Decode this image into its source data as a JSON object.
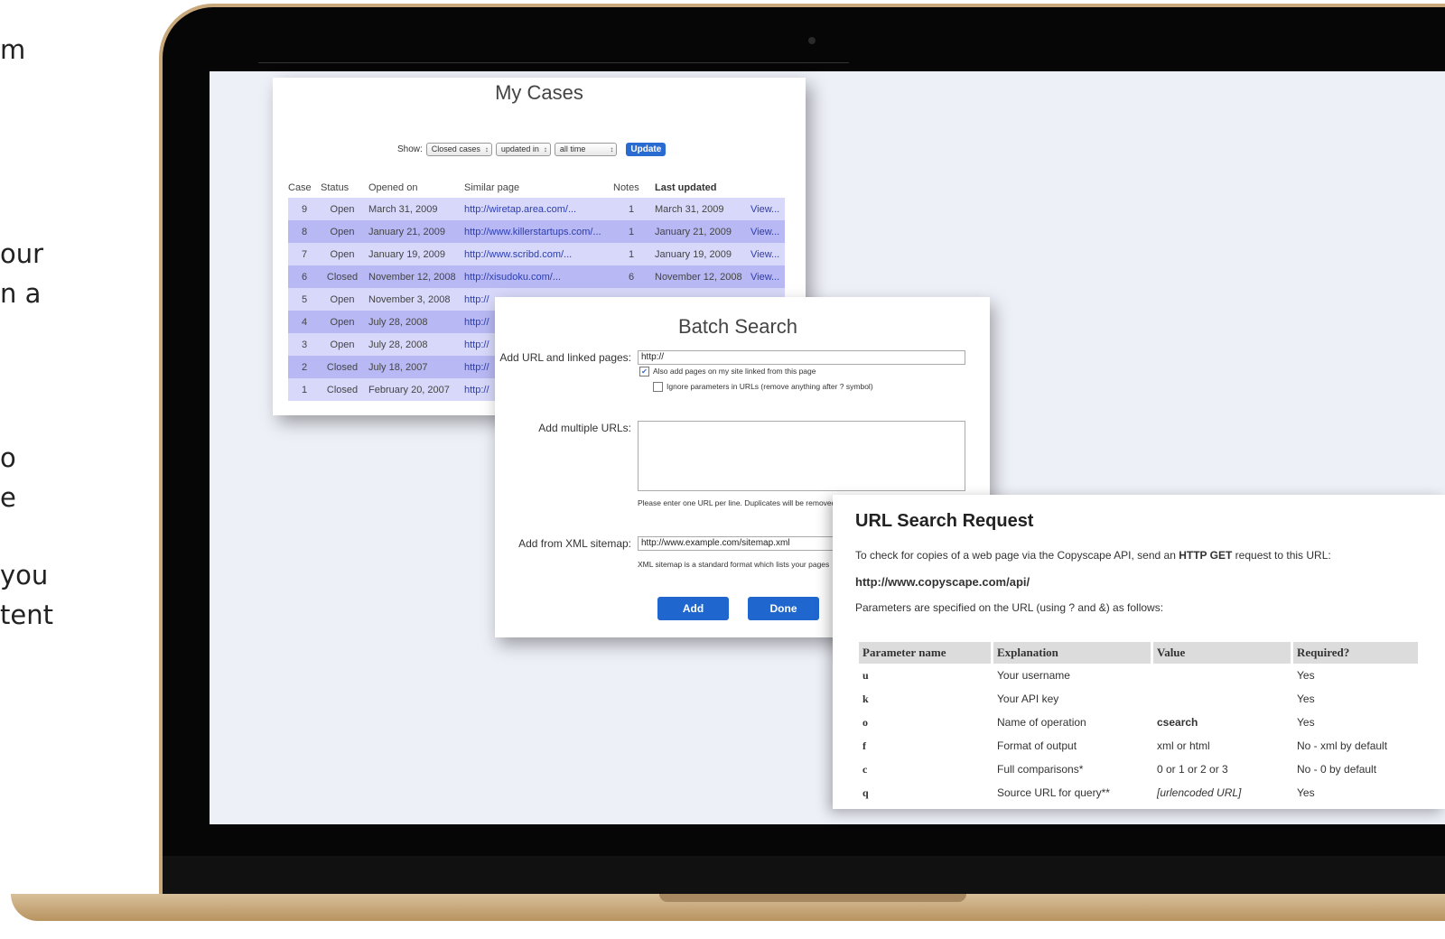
{
  "side_text": [
    "m",
    "our",
    "n a",
    "o",
    "e",
    "you",
    "tent"
  ],
  "my_cases": {
    "title": "My Cases",
    "filter": {
      "show_label": "Show:",
      "status_select": "Closed cases",
      "date_type_select": "updated in",
      "period_select": "all time",
      "update_button": "Update"
    },
    "columns": [
      "Case",
      "Status",
      "Opened on",
      "Similar page",
      "Notes",
      "Last updated"
    ],
    "rows": [
      {
        "case": "9",
        "status": "Open",
        "opened": "March 31, 2009",
        "page": "http://wiretap.area.com/...",
        "notes": "1",
        "updated": "March 31, 2009",
        "action": "View..."
      },
      {
        "case": "8",
        "status": "Open",
        "opened": "January 21, 2009",
        "page": "http://www.killerstartups.com/...",
        "notes": "1",
        "updated": "January 21, 2009",
        "action": "View..."
      },
      {
        "case": "7",
        "status": "Open",
        "opened": "January 19, 2009",
        "page": "http://www.scribd.com/...",
        "notes": "1",
        "updated": "January 19, 2009",
        "action": "View..."
      },
      {
        "case": "6",
        "status": "Closed",
        "opened": "November 12, 2008",
        "page": "http://xisudoku.com/...",
        "notes": "6",
        "updated": "November 12, 2008",
        "action": "View..."
      },
      {
        "case": "5",
        "status": "Open",
        "opened": "November 3, 2008",
        "page": "http://",
        "notes": "",
        "updated": "",
        "action": ""
      },
      {
        "case": "4",
        "status": "Open",
        "opened": "July 28, 2008",
        "page": "http://",
        "notes": "",
        "updated": "",
        "action": ""
      },
      {
        "case": "3",
        "status": "Open",
        "opened": "July 28, 2008",
        "page": "http://",
        "notes": "",
        "updated": "",
        "action": ""
      },
      {
        "case": "2",
        "status": "Closed",
        "opened": "July 18, 2007",
        "page": "http://",
        "notes": "",
        "updated": "",
        "action": ""
      },
      {
        "case": "1",
        "status": "Closed",
        "opened": "February 20, 2007",
        "page": "http://",
        "notes": "",
        "updated": "",
        "action": ""
      }
    ]
  },
  "batch_search": {
    "title": "Batch Search",
    "add_url_label": "Add URL and linked pages:",
    "add_url_value": "http://",
    "also_add_label": "Also add pages on my site linked from this page",
    "also_add_checked": true,
    "ignore_params_label": "Ignore parameters in URLs (remove anything after ? symbol)",
    "ignore_params_checked": false,
    "multiple_label": "Add multiple URLs:",
    "multiple_note": "Please enter one URL per line. Duplicates will be removed",
    "xml_label": "Add from XML sitemap:",
    "xml_value": "http://www.example.com/sitemap.xml",
    "xml_note": "XML sitemap is a standard format which lists your pages",
    "add_button": "Add",
    "done_button": "Done"
  },
  "url_search": {
    "title": "URL Search Request",
    "intro_pre": "To check for copies of a web page via the Copyscape API, send an ",
    "intro_bold": "HTTP GET",
    "intro_post": " request to this URL:",
    "endpoint": "http://www.copyscape.com/api/",
    "params_intro": "Parameters are specified on the URL (using ? and &) as follows:",
    "columns": [
      "Parameter name",
      "Explanation",
      "Value",
      "Required?"
    ],
    "rows": [
      {
        "name": "u",
        "explanation": "Your username",
        "value": "",
        "required": "Yes"
      },
      {
        "name": "k",
        "explanation": "Your API key",
        "value": "",
        "required": "Yes"
      },
      {
        "name": "o",
        "explanation": "Name of operation",
        "value": "csearch",
        "required": "Yes"
      },
      {
        "name": "f",
        "explanation": "Format of output",
        "value": "xml or html",
        "required": "No - xml by default"
      },
      {
        "name": "c",
        "explanation": "Full comparisons*",
        "value": "0 or 1 or 2 or 3",
        "required": "No - 0 by default"
      },
      {
        "name": "q",
        "explanation": "Source URL for query**",
        "value": "[urlencoded URL]",
        "required": "Yes"
      }
    ]
  }
}
